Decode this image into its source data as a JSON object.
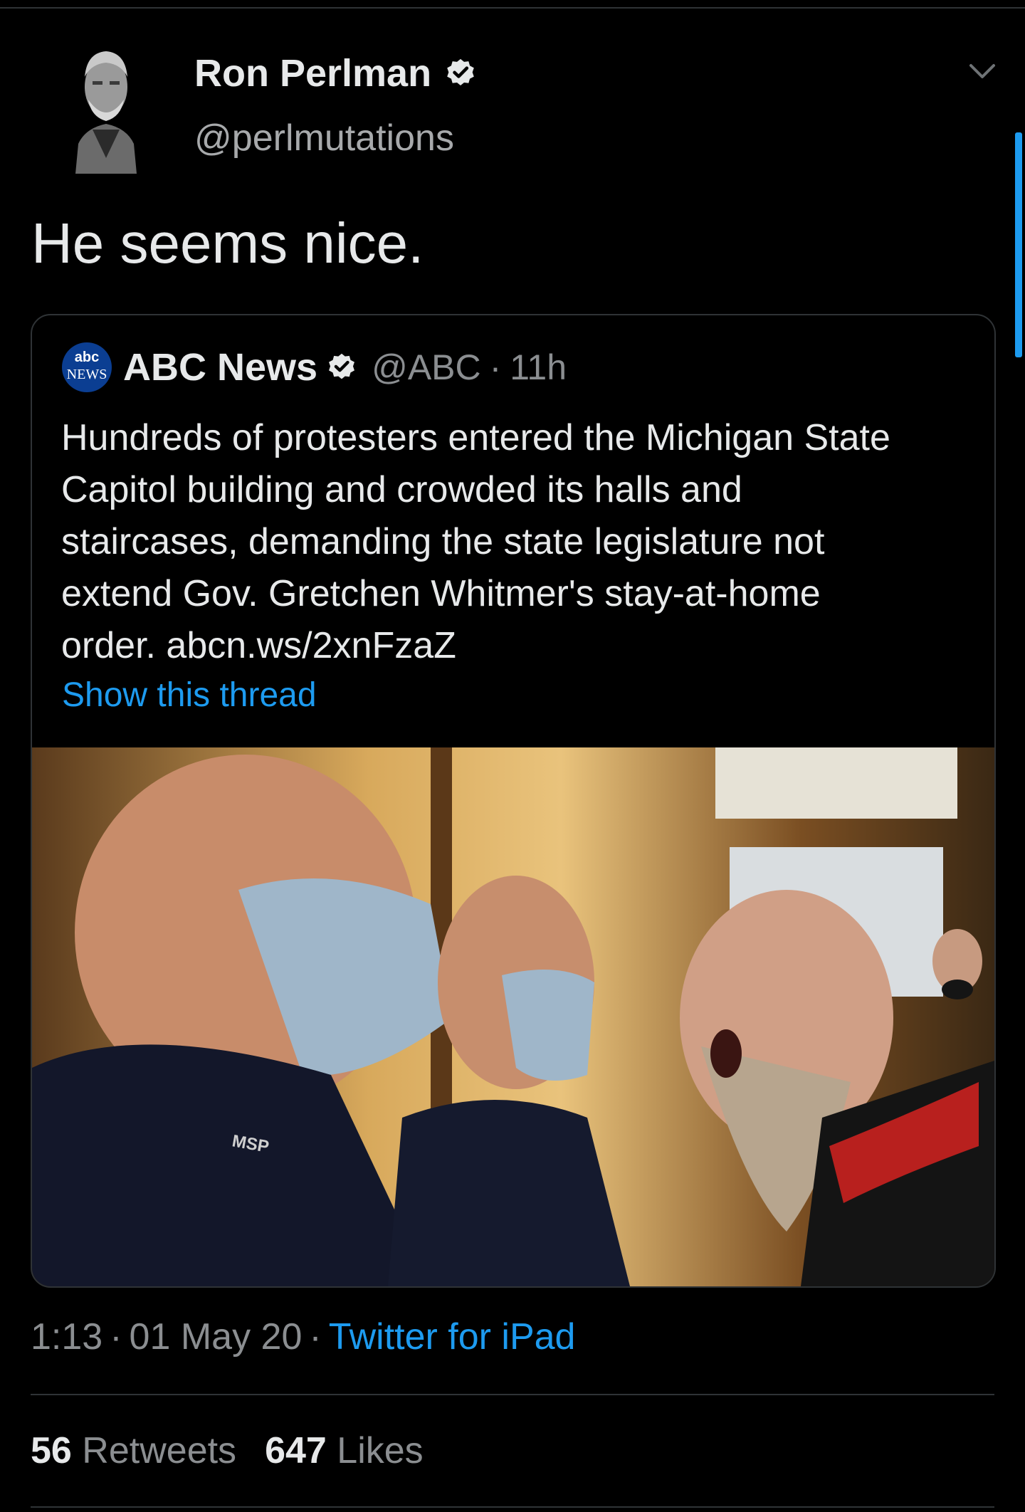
{
  "author": {
    "display_name": "Ron Perlman",
    "handle": "@perlmutations"
  },
  "tweet": {
    "text": "He seems nice."
  },
  "quoted": {
    "logo_top": "abc",
    "logo_bottom": "NEWS",
    "name": "ABC News",
    "handle": "@ABC",
    "separator": "·",
    "time": "11h",
    "body_lines": [
      "Hundreds of protesters entered the Michigan State",
      "Capitol building and crowded its halls and",
      "staircases, demanding the state legislature not",
      "extend Gov. Gretchen Whitmer's stay-at-home",
      "order. abcn.ws/2xnFzaZ"
    ],
    "show_thread": "Show this thread",
    "photo_label": "MSP"
  },
  "meta": {
    "time": "1:13",
    "date": "01 May 20",
    "separator": "·",
    "source": "Twitter for iPad"
  },
  "stats": {
    "retweets_count": "56",
    "retweets_label": "Retweets",
    "likes_count": "647",
    "likes_label": "Likes"
  },
  "icons": {
    "verified": "verified-badge-icon",
    "menu": "chevron-down-icon"
  },
  "colors": {
    "background": "#000000",
    "link": "#1d9bf0",
    "secondary_text": "#8b8e91",
    "divider": "#2f3336",
    "abc_logo": "#0b3e92"
  }
}
